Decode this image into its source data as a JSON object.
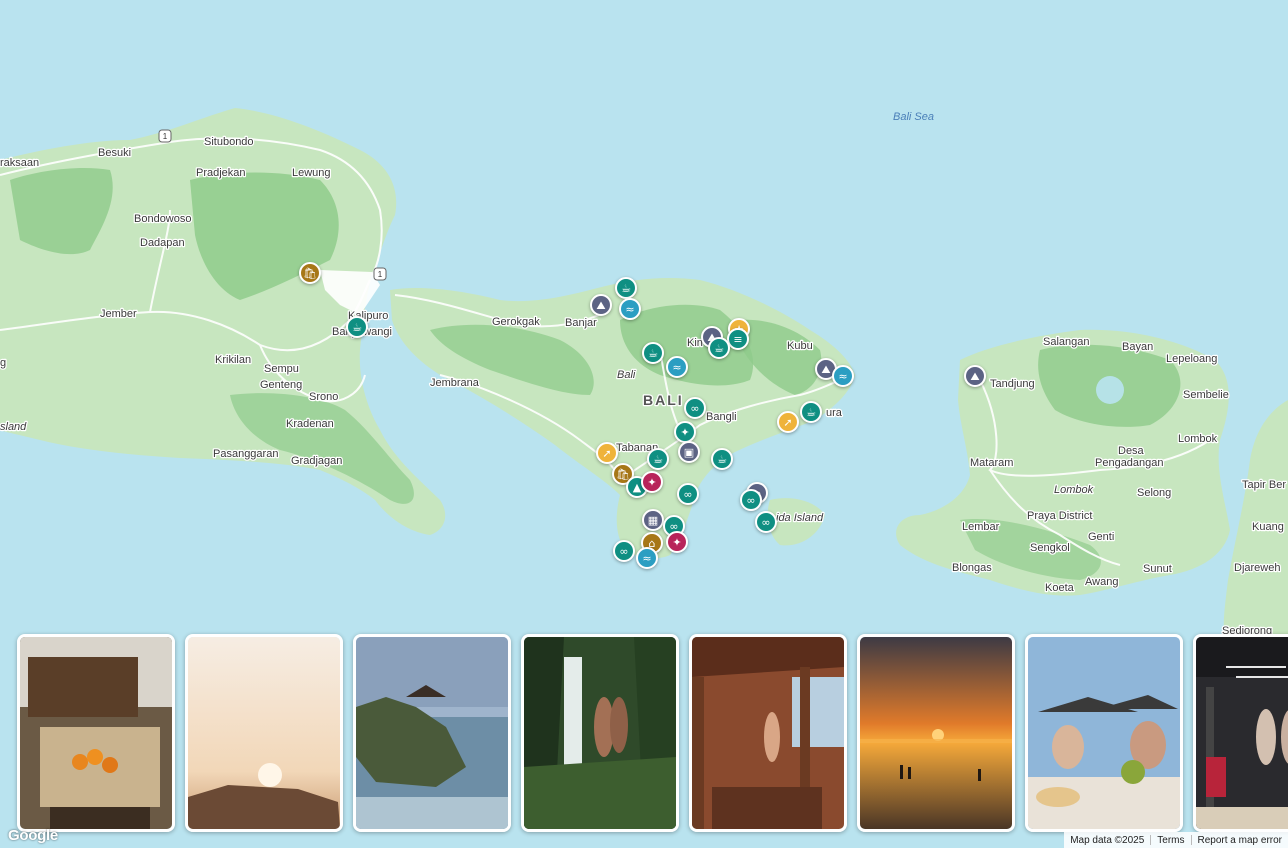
{
  "map": {
    "sea_label": "Bali Sea",
    "region_label": "BALI",
    "place_labels": [
      {
        "id": "raksaan",
        "text": "raksaan"
      },
      {
        "id": "besuki",
        "text": "Besuki"
      },
      {
        "id": "situbondo",
        "text": "Situbondo"
      },
      {
        "id": "pradjekan",
        "text": "Pradjekan"
      },
      {
        "id": "lewung",
        "text": "Lewung"
      },
      {
        "id": "bondowoso",
        "text": "Bondowoso"
      },
      {
        "id": "dadapan",
        "text": "Dadapan"
      },
      {
        "id": "jember",
        "text": "Jember"
      },
      {
        "id": "kalipuro",
        "text": "Kalipuro"
      },
      {
        "id": "banyuwangi",
        "text": "Banyuwangi"
      },
      {
        "id": "krikilan",
        "text": "Krikilan"
      },
      {
        "id": "sempu",
        "text": "Sempu"
      },
      {
        "id": "genteng",
        "text": "Genteng"
      },
      {
        "id": "srono",
        "text": "Srono"
      },
      {
        "id": "kradenan",
        "text": "Kradenan"
      },
      {
        "id": "pasanggaran",
        "text": "Pasanggaran"
      },
      {
        "id": "gradjagan",
        "text": "Gradjagan"
      },
      {
        "id": "island-left",
        "text": "sland"
      },
      {
        "id": "gerokgak",
        "text": "Gerokgak"
      },
      {
        "id": "banjar",
        "text": "Banjar"
      },
      {
        "id": "kintamani",
        "text": "Kin"
      },
      {
        "id": "kubu",
        "text": "Kubu"
      },
      {
        "id": "jembrana",
        "text": "Jembrana"
      },
      {
        "id": "bangli",
        "text": "Bangli"
      },
      {
        "id": "tabanan",
        "text": "Tabanan"
      },
      {
        "id": "amlapura",
        "text": "ura"
      },
      {
        "id": "nusa-penida",
        "text": "ida Island"
      },
      {
        "id": "salangan",
        "text": "Salangan"
      },
      {
        "id": "bayan",
        "text": "Bayan"
      },
      {
        "id": "lepeloang",
        "text": "Lepeloang"
      },
      {
        "id": "tandjung",
        "text": "Tandjung"
      },
      {
        "id": "sembelie",
        "text": "Sembelie"
      },
      {
        "id": "lombok-town",
        "text": "Lombok"
      },
      {
        "id": "mataram",
        "text": "Mataram"
      },
      {
        "id": "desa-pengadangan-1",
        "text": "Desa"
      },
      {
        "id": "desa-pengadangan-2",
        "text": "Pengadangan"
      },
      {
        "id": "lombok-island",
        "text": "Lombok"
      },
      {
        "id": "selong",
        "text": "Selong"
      },
      {
        "id": "tapir-ber",
        "text": "Tapir Ber"
      },
      {
        "id": "lembar",
        "text": "Lembar"
      },
      {
        "id": "praya-district",
        "text": "Praya District"
      },
      {
        "id": "kuang",
        "text": "Kuang"
      },
      {
        "id": "genti",
        "text": "Genti"
      },
      {
        "id": "sengkol",
        "text": "Sengkol"
      },
      {
        "id": "djareweh",
        "text": "Djareweh"
      },
      {
        "id": "blongas",
        "text": "Blongas"
      },
      {
        "id": "sunut",
        "text": "Sunut"
      },
      {
        "id": "awang",
        "text": "Awang"
      },
      {
        "id": "koeta",
        "text": "Koeta"
      },
      {
        "id": "sediorong",
        "text": "Sediorong"
      },
      {
        "id": "bali-italic",
        "text": "Bali"
      },
      {
        "id": "g-letter",
        "text": "g"
      }
    ],
    "route_shields": [
      "1",
      "1"
    ]
  },
  "photos": [
    {
      "id": "market",
      "alt": "Market stall with oranges"
    },
    {
      "id": "sunset-rock",
      "alt": "Hazy sunset over rock"
    },
    {
      "id": "temple",
      "alt": "Sea temple on rock"
    },
    {
      "id": "waterfall",
      "alt": "Couple at jungle waterfall"
    },
    {
      "id": "balcony",
      "alt": "Woman on wooden balcony"
    },
    {
      "id": "beach-sunset",
      "alt": "Beach sunset"
    },
    {
      "id": "dinner",
      "alt": "Couple dining with coconuts"
    },
    {
      "id": "gym",
      "alt": "Gym interior"
    }
  ],
  "footer": {
    "logo": "Google",
    "map_data": "Map data ©2025",
    "terms": "Terms",
    "report": "Report a map error"
  },
  "colors": {
    "sea": "#b9e3ef",
    "land": "#c7e6bf",
    "forest": "#8fcb8b",
    "teal": "#0f8f82",
    "slate": "#5c6384",
    "gold": "#efb33a",
    "brown": "#a77717",
    "blue": "#2b9ec2",
    "crimson": "#b8245a"
  }
}
